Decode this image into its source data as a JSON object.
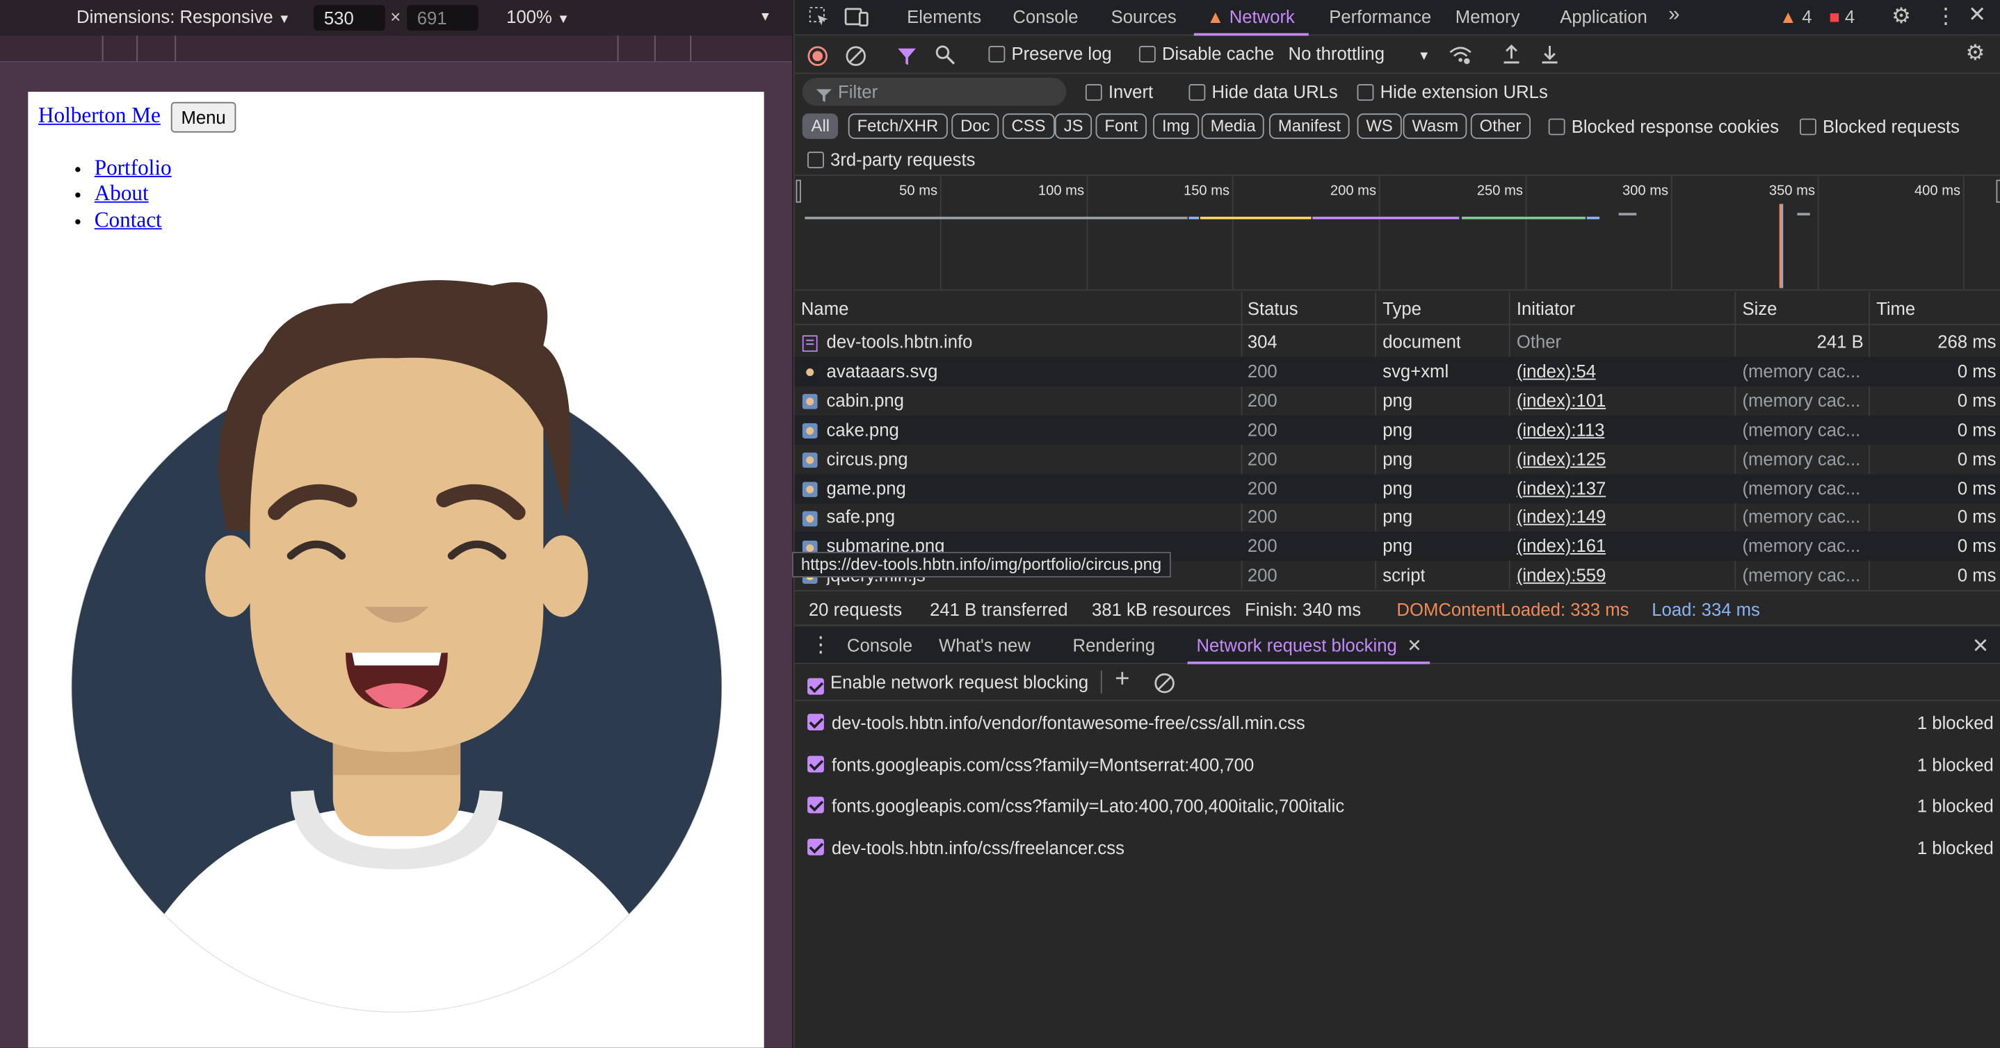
{
  "device_toolbar": {
    "dimensions_label": "Dimensions: Responsive",
    "width_value": "530",
    "height_value": "691",
    "zoom": "100%"
  },
  "page": {
    "brand_link": "Holberton Me",
    "menu_button": "Menu",
    "nav_links": [
      "Portfolio",
      "About",
      "Contact"
    ]
  },
  "devtools": {
    "tabs": [
      "Elements",
      "Console",
      "Sources",
      "Network",
      "Performance",
      "Memory",
      "Application"
    ],
    "active_tab": "Network",
    "warnings_count": "4",
    "errors_count": "4"
  },
  "network_toolbar": {
    "preserve_log": "Preserve log",
    "disable_cache": "Disable cache",
    "throttling": "No throttling",
    "filter_placeholder": "Filter",
    "invert": "Invert",
    "hide_data_urls": "Hide data URLs",
    "hide_extension_urls": "Hide extension URLs",
    "type_filters": [
      "All",
      "Fetch/XHR",
      "Doc",
      "CSS",
      "JS",
      "Font",
      "Img",
      "Media",
      "Manifest",
      "WS",
      "Wasm",
      "Other"
    ],
    "blocked_response_cookies": "Blocked response cookies",
    "blocked_requests": "Blocked requests",
    "third_party_requests": "3rd-party requests"
  },
  "timeline": {
    "ticks": [
      "50 ms",
      "100 ms",
      "150 ms",
      "200 ms",
      "250 ms",
      "300 ms",
      "350 ms",
      "400 ms"
    ]
  },
  "table": {
    "columns": [
      "Name",
      "Status",
      "Type",
      "Initiator",
      "Size",
      "Time"
    ],
    "rows": [
      {
        "name": "dev-tools.hbtn.info",
        "status": "304",
        "type": "document",
        "initiator": "Other",
        "size": "241 B",
        "time": "268 ms"
      },
      {
        "name": "avataaars.svg",
        "status": "200",
        "type": "svg+xml",
        "initiator": "(index):54",
        "size": "(memory cac...",
        "time": "0 ms"
      },
      {
        "name": "cabin.png",
        "status": "200",
        "type": "png",
        "initiator": "(index):101",
        "size": "(memory cac...",
        "time": "0 ms"
      },
      {
        "name": "cake.png",
        "status": "200",
        "type": "png",
        "initiator": "(index):113",
        "size": "(memory cac...",
        "time": "0 ms"
      },
      {
        "name": "circus.png",
        "status": "200",
        "type": "png",
        "initiator": "(index):125",
        "size": "(memory cac...",
        "time": "0 ms"
      },
      {
        "name": "game.png",
        "status": "200",
        "type": "png",
        "initiator": "(index):137",
        "size": "(memory cac...",
        "time": "0 ms"
      },
      {
        "name": "safe.png",
        "status": "200",
        "type": "png",
        "initiator": "(index):149",
        "size": "(memory cac...",
        "time": "0 ms"
      },
      {
        "name": "submarine.png",
        "status": "200",
        "type": "png",
        "initiator": "(index):161",
        "size": "(memory cac...",
        "time": "0 ms"
      },
      {
        "name": "jquery.min.js",
        "status": "200",
        "type": "script",
        "initiator": "(index):559",
        "size": "(memory cac...",
        "time": "0 ms"
      }
    ],
    "tooltip": "https://dev-tools.hbtn.info/img/portfolio/circus.png"
  },
  "summary": {
    "requests": "20 requests",
    "transferred": "241 B transferred",
    "resources": "381 kB resources",
    "finish": "Finish: 340 ms",
    "dom_content_loaded": "DOMContentLoaded: 333 ms",
    "load": "Load: 334 ms"
  },
  "drawer": {
    "tabs": [
      "Console",
      "What's new",
      "Rendering",
      "Network request blocking"
    ],
    "active_tab": "Network request blocking",
    "enable_label": "Enable network request blocking",
    "patterns": [
      {
        "pattern": "dev-tools.hbtn.info/vendor/fontawesome-free/css/all.min.css",
        "count": "1 blocked"
      },
      {
        "pattern": "fonts.googleapis.com/css?family=Montserrat:400,700",
        "count": "1 blocked"
      },
      {
        "pattern": "fonts.googleapis.com/css?family=Lato:400,700,400italic,700italic",
        "count": "1 blocked"
      },
      {
        "pattern": "dev-tools.hbtn.info/css/freelancer.css",
        "count": "1 blocked"
      }
    ]
  },
  "colors": {
    "accent": "#c58af9",
    "dcl": "#f28b54",
    "load": "#8ab4f8",
    "avatar_bg": "#2c3b4e",
    "skin": "#e6bf8f",
    "hair": "#4a3328"
  }
}
